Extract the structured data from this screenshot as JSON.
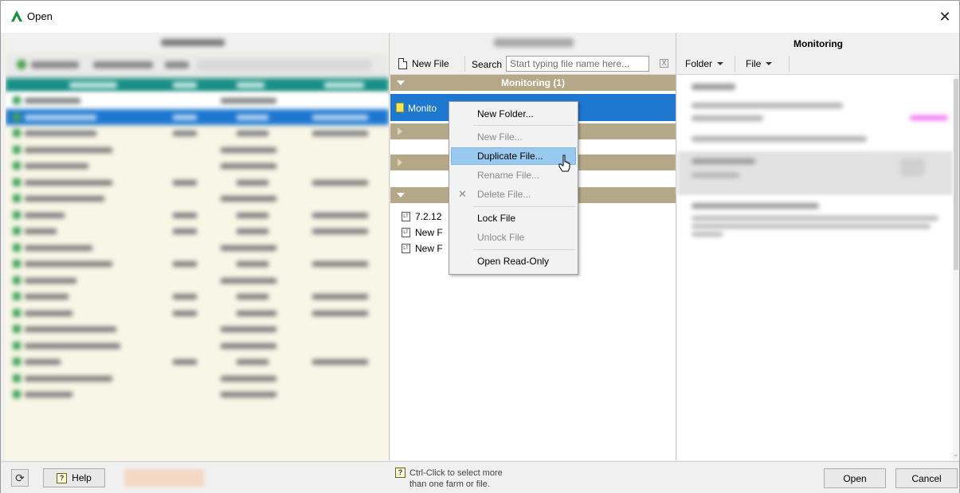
{
  "window": {
    "title": "Open",
    "accent": "#1a8f3c"
  },
  "middle": {
    "toolbar": {
      "new_file_label": "New File",
      "search_label": "Search",
      "search_placeholder": "Start typing file name here...",
      "clear_symbol": "X"
    },
    "group_title": "Monitoring (1)",
    "selected_file": "Monito",
    "files": [
      "7.2.12",
      "New F",
      "New F"
    ]
  },
  "context_menu": {
    "items": [
      {
        "label": "New Folder...",
        "disabled": false
      },
      {
        "label": "New File...",
        "disabled": true
      },
      {
        "label": "Duplicate File...",
        "disabled": false,
        "hover": true
      },
      {
        "label": "Rename File...",
        "disabled": true
      },
      {
        "label": "Delete File...",
        "disabled": true
      },
      {
        "label": "Lock File",
        "disabled": false
      },
      {
        "label": "Unlock File",
        "disabled": true
      },
      {
        "label": "Open Read-Only",
        "disabled": false
      }
    ]
  },
  "right": {
    "title": "Monitoring",
    "folder_label": "Folder",
    "file_label": "File"
  },
  "bottom": {
    "help_label": "Help",
    "hint_line1": "Ctrl-Click to select more",
    "hint_line2": "than one farm or file.",
    "open_label": "Open",
    "cancel_label": "Cancel"
  },
  "colors": {
    "selection_blue": "#1e78d0",
    "group_bar": "#b5a888",
    "menu_hover": "#99c9ef",
    "table_header_teal": "#1a8f86"
  }
}
